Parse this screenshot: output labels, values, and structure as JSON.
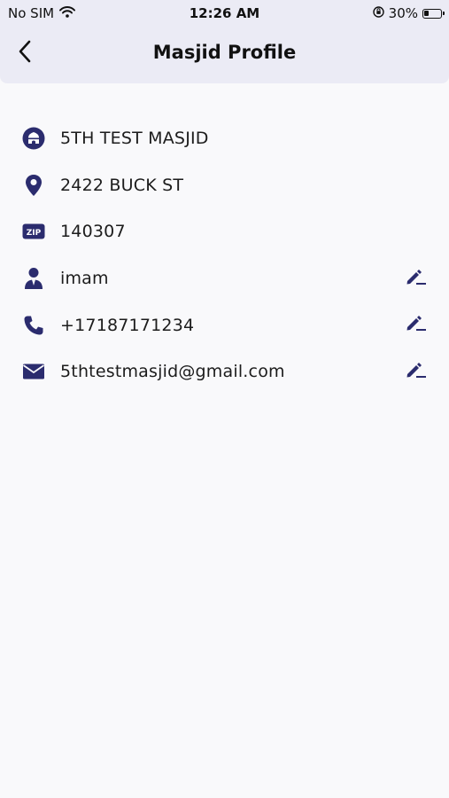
{
  "status_bar": {
    "carrier": "No SIM",
    "time": "12:26 AM",
    "battery_percent": "30%",
    "battery_level": 0.3,
    "icons": [
      "wifi-icon",
      "orientation-lock-icon",
      "battery-icon"
    ]
  },
  "nav": {
    "title": "Masjid Profile",
    "back_icon": "chevron-left-icon"
  },
  "colors": {
    "accent": "#2b2c6e",
    "header_bg": "#ebebf5",
    "page_bg": "#f9f9fb"
  },
  "profile": {
    "name": {
      "value": "5TH TEST MASJID",
      "icon": "masjid-icon"
    },
    "address": {
      "value": "2422 BUCK ST",
      "icon": "location-pin-icon"
    },
    "zip": {
      "value": "140307",
      "icon": "zip-icon",
      "icon_label": "ZIP"
    },
    "imam": {
      "value": "imam",
      "icon": "person-icon",
      "editable": true
    },
    "phone": {
      "value": "+17187171234",
      "icon": "phone-icon",
      "editable": true
    },
    "email": {
      "value": "5thtestmasjid@gmail.com",
      "icon": "mail-icon",
      "editable": true
    }
  }
}
